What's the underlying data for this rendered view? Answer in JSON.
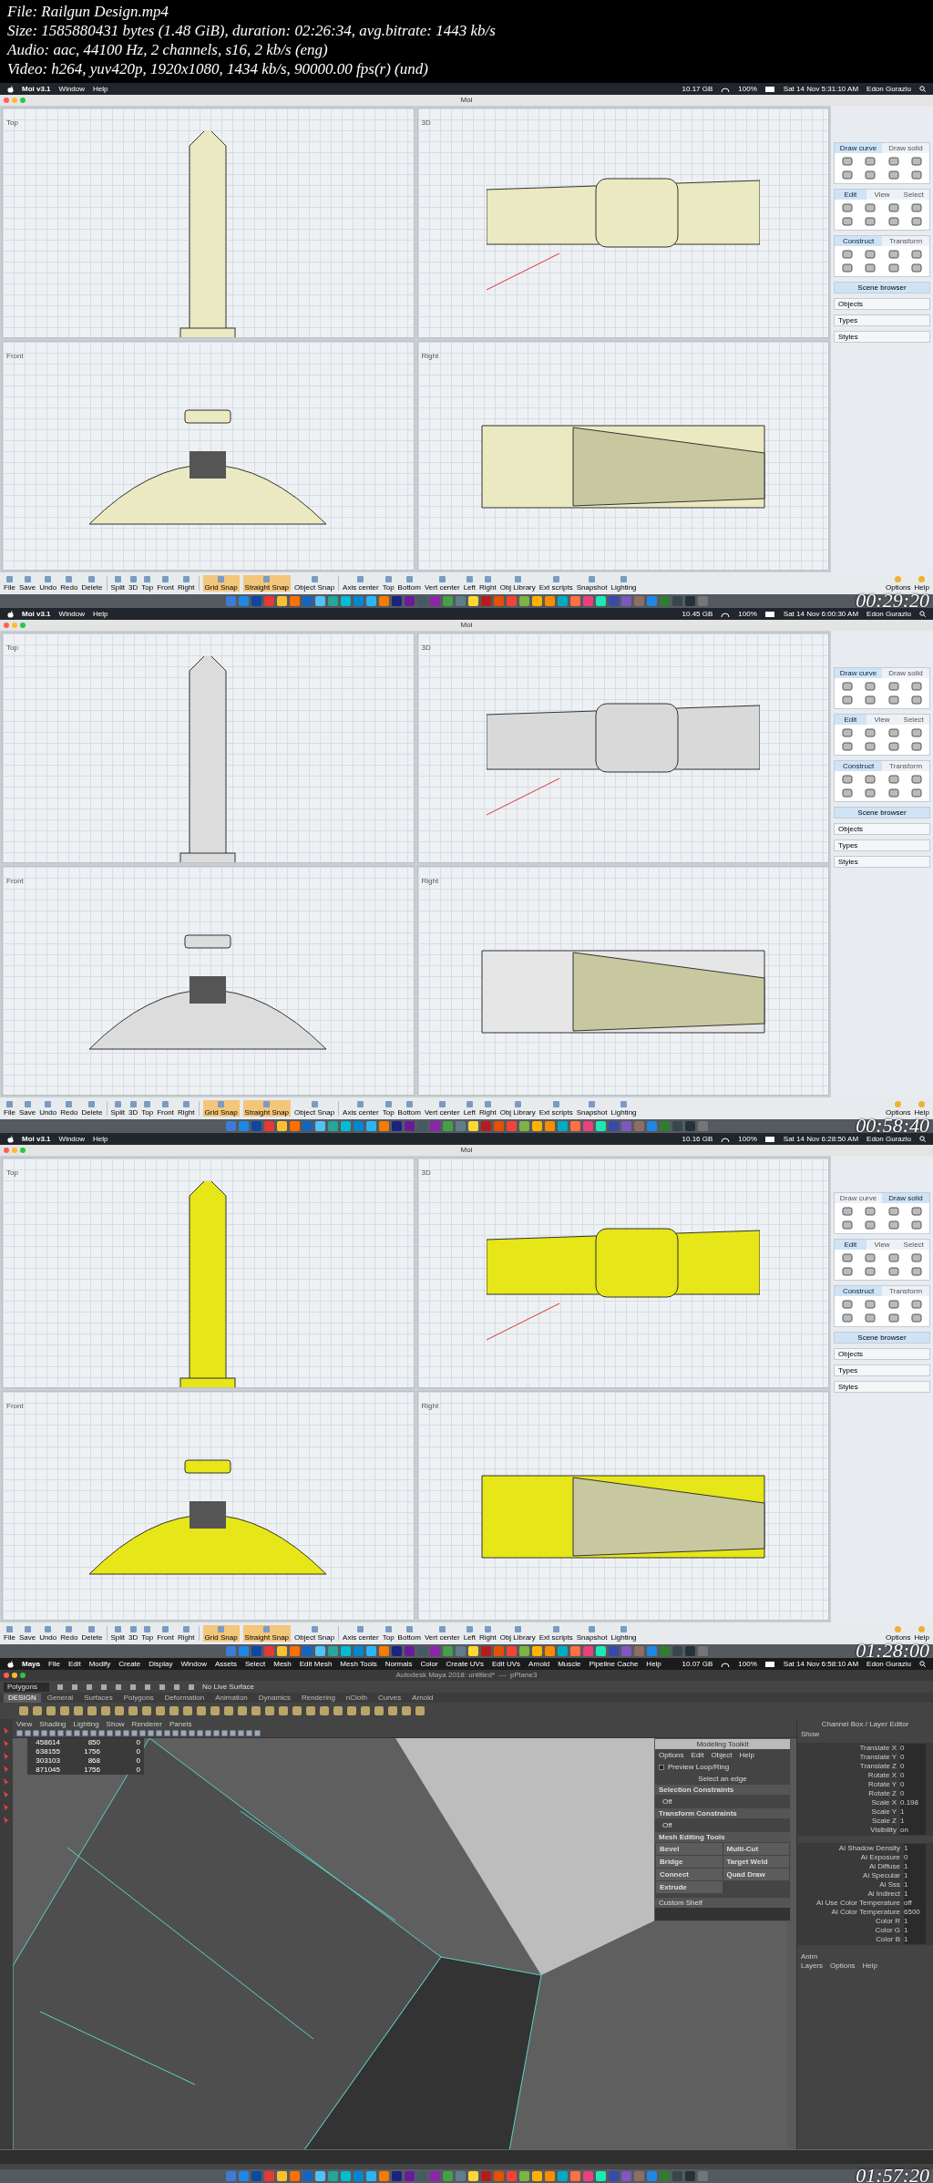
{
  "file_info": [
    "File: Railgun Design.mp4",
    "Size: 1585880431 bytes (1.48 GiB), duration: 02:26:34, avg.bitrate: 1443 kb/s",
    "Audio: aac, 44100 Hz, 2 channels, s16, 2 kb/s (eng)",
    "Video: h264, yuv420p, 1920x1080, 1434 kb/s, 90000.00 fps(r) (und)"
  ],
  "frames": [
    {
      "kind": "moi",
      "app_menu": [
        "Moi v3.1",
        "Window",
        "Help"
      ],
      "memory": "10.17 GB",
      "battery": "100%",
      "date": "Sat 14 Nov 5:31:10 AM",
      "user": "Edon Guraziu",
      "title": "Moi",
      "viewports": [
        {
          "label": "Top",
          "color": "#ebe9c2"
        },
        {
          "label": "3D",
          "color": "#ebe9c2"
        },
        {
          "label": "Front",
          "color": "#ebe9c2"
        },
        {
          "label": "Right",
          "color": "#ebe9c2"
        }
      ],
      "panel_tabs": [
        [
          {
            "label": "Draw curve",
            "selected": true
          },
          {
            "label": "Draw solid",
            "selected": false
          }
        ],
        [
          {
            "label": "Edit",
            "selected": true
          },
          {
            "label": "View",
            "selected": false
          },
          {
            "label": "Select",
            "selected": false
          }
        ],
        [
          {
            "label": "Construct",
            "selected": true
          },
          {
            "label": "Transform",
            "selected": false
          }
        ]
      ],
      "panel_footer": [
        "Scene browser",
        "Objects",
        "Types",
        "Styles"
      ],
      "toolbar": [
        "File",
        "Save",
        "Undo",
        "Redo",
        "Delete",
        "Split",
        "3D",
        "Top",
        "Front",
        "Right",
        "Grid Snap",
        "Straight Snap",
        "Object Snap",
        "Axis center",
        "Top",
        "Bottom",
        "Vert center",
        "Left",
        "Right",
        "Obj Library",
        "Ext scripts",
        "Snapshot",
        "Lighting"
      ],
      "toolbar_right": [
        "Options",
        "Help"
      ],
      "timestamp": "00:29:20"
    },
    {
      "kind": "moi",
      "app_menu": [
        "Moi v3.1",
        "Window",
        "Help"
      ],
      "memory": "10.45 GB",
      "battery": "100%",
      "date": "Sat 14 Nov 6:00:30 AM",
      "user": "Edon Guraziu",
      "title": "Moi",
      "viewports": [
        {
          "label": "Top",
          "color": "#dcdcdc"
        },
        {
          "label": "3D",
          "color": "#d9d9d9"
        },
        {
          "label": "Front",
          "color": "#dcdcdc"
        },
        {
          "label": "Right",
          "color": "#e6e6e6"
        }
      ],
      "panel_tabs": [
        [
          {
            "label": "Draw curve",
            "selected": true
          },
          {
            "label": "Draw solid",
            "selected": false
          }
        ],
        [
          {
            "label": "Edit",
            "selected": true
          },
          {
            "label": "View",
            "selected": false
          },
          {
            "label": "Select",
            "selected": false
          }
        ],
        [
          {
            "label": "Construct",
            "selected": true
          },
          {
            "label": "Transform",
            "selected": false
          }
        ]
      ],
      "panel_footer": [
        "Scene browser",
        "Objects",
        "Types",
        "Styles"
      ],
      "toolbar": [
        "File",
        "Save",
        "Undo",
        "Redo",
        "Delete",
        "Split",
        "3D",
        "Top",
        "Front",
        "Right",
        "Grid Snap",
        "Straight Snap",
        "Object Snap",
        "Axis center",
        "Top",
        "Bottom",
        "Vert center",
        "Left",
        "Right",
        "Obj Library",
        "Ext scripts",
        "Snapshot",
        "Lighting"
      ],
      "toolbar_right": [
        "Options",
        "Help"
      ],
      "timestamp": "00:58:40"
    },
    {
      "kind": "moi",
      "app_menu": [
        "Moi v3.1",
        "Window",
        "Help"
      ],
      "memory": "10.16 GB",
      "battery": "100%",
      "date": "Sat 14 Nov 6:28:50 AM",
      "user": "Edon Guraziu",
      "title": "Moi",
      "viewports": [
        {
          "label": "Top",
          "color": "#e6e619"
        },
        {
          "label": "3D",
          "color": "#e6e619"
        },
        {
          "label": "Front",
          "color": "#e6e619"
        },
        {
          "label": "Right",
          "color": "#e6e619"
        }
      ],
      "panel_tabs": [
        [
          {
            "label": "Draw curve",
            "selected": false
          },
          {
            "label": "Draw solid",
            "selected": true
          }
        ],
        [
          {
            "label": "Edit",
            "selected": true
          },
          {
            "label": "View",
            "selected": false
          },
          {
            "label": "Select",
            "selected": false
          }
        ],
        [
          {
            "label": "Construct",
            "selected": true
          },
          {
            "label": "Transform",
            "selected": false
          }
        ]
      ],
      "panel_footer": [
        "Scene browser",
        "Objects",
        "Types",
        "Styles"
      ],
      "toolbar": [
        "File",
        "Save",
        "Undo",
        "Redo",
        "Delete",
        "Split",
        "3D",
        "Top",
        "Front",
        "Right",
        "Grid Snap",
        "Straight Snap",
        "Object Snap",
        "Axis center",
        "Top",
        "Bottom",
        "Vert center",
        "Left",
        "Right",
        "Obj Library",
        "Ext scripts",
        "Snapshot",
        "Lighting"
      ],
      "toolbar_right": [
        "Options",
        "Help"
      ],
      "timestamp": "01:28:00"
    },
    {
      "kind": "maya",
      "app_menu": [
        "Maya",
        "File",
        "Edit",
        "Modify",
        "Create",
        "Display",
        "Window",
        "Assets",
        "Select",
        "Mesh",
        "Edit Mesh",
        "Mesh Tools",
        "Normals",
        "Color",
        "Create UVs",
        "Edit UVs",
        "Arnold",
        "Muscle",
        "Pipeline Cache",
        "Help"
      ],
      "memory": "10.07 GB",
      "battery": "100%",
      "date": "Sat 14 Nov 6:58:10 AM",
      "user": "Edon Guraziu",
      "title": "Autodesk Maya 2018: untitled*  ---  pPlane3",
      "mode": "Polygons",
      "live_surface": "No Live Surface",
      "shelf_tabs": [
        {
          "label": "DESIGN",
          "selected": true
        },
        {
          "label": "General",
          "selected": false
        },
        {
          "label": "Surfaces",
          "selected": false
        },
        {
          "label": "Polygons",
          "selected": false
        },
        {
          "label": "Deformation",
          "selected": false
        },
        {
          "label": "Animation",
          "selected": false
        },
        {
          "label": "Dynamics",
          "selected": false
        },
        {
          "label": "Rendering",
          "selected": false
        },
        {
          "label": "nCloth",
          "selected": false
        },
        {
          "label": "Curves",
          "selected": false
        },
        {
          "label": "Arnold",
          "selected": false
        }
      ],
      "panel_menu": [
        "View",
        "Shading",
        "Lighting",
        "Show",
        "Renderer",
        "Panels"
      ],
      "stats": [
        [
          "458614",
          "850",
          "0"
        ],
        [
          "638155",
          "1756",
          "0"
        ],
        [
          "303103",
          "868",
          "0"
        ],
        [
          "871045",
          "1756",
          "0"
        ]
      ],
      "toolkit": {
        "title": "Modeling Toolkit",
        "menu": [
          "Options",
          "Edit",
          "Object",
          "Help"
        ],
        "preview": "Preview Loop/Ring",
        "preview_checked": false,
        "hint": "Select an edge",
        "sections": [
          {
            "title": "Selection Constraints",
            "value": "Off"
          },
          {
            "title": "Transform Constraints",
            "value": "Off"
          }
        ],
        "tools_title": "Mesh Editing Tools",
        "tools": [
          "Bevel",
          "Multi-Cut",
          "Bridge",
          "Target Weld",
          "Connect",
          "Quad Draw",
          "Extrude"
        ],
        "shelf": "Custom Shelf"
      },
      "channel_box": {
        "title": "Channel Box / Layer Editor",
        "menu": "Show",
        "attributes": [
          [
            "Translate X",
            "0"
          ],
          [
            "Translate Y",
            "0"
          ],
          [
            "Translate Z",
            "0"
          ],
          [
            "Rotate X",
            "0"
          ],
          [
            "Rotate Y",
            "0"
          ],
          [
            "Rotate Z",
            "0"
          ],
          [
            "Scale X",
            "0.198"
          ],
          [
            "Scale Y",
            "1"
          ],
          [
            "Scale Z",
            "1"
          ],
          [
            "Visibility",
            "on"
          ]
        ],
        "shape_attributes": [
          [
            "Ai Shadow Density",
            "1"
          ],
          [
            "Ai Exposure",
            "0"
          ],
          [
            "Ai Diffuse",
            "1"
          ],
          [
            "Ai Specular",
            "1"
          ],
          [
            "Ai Sss",
            "1"
          ],
          [
            "Ai Indirect",
            "1"
          ],
          [
            "Ai Use Color Temperature",
            "off"
          ],
          [
            "Ai Color Temperature",
            "6500"
          ],
          [
            "Color R",
            "1"
          ],
          [
            "Color G",
            "1"
          ],
          [
            "Color B",
            "1"
          ]
        ],
        "layer_tab": "Anim",
        "layer_menu": [
          "Layers",
          "Options",
          "Help"
        ]
      },
      "timestamp": "01:57:20"
    }
  ]
}
